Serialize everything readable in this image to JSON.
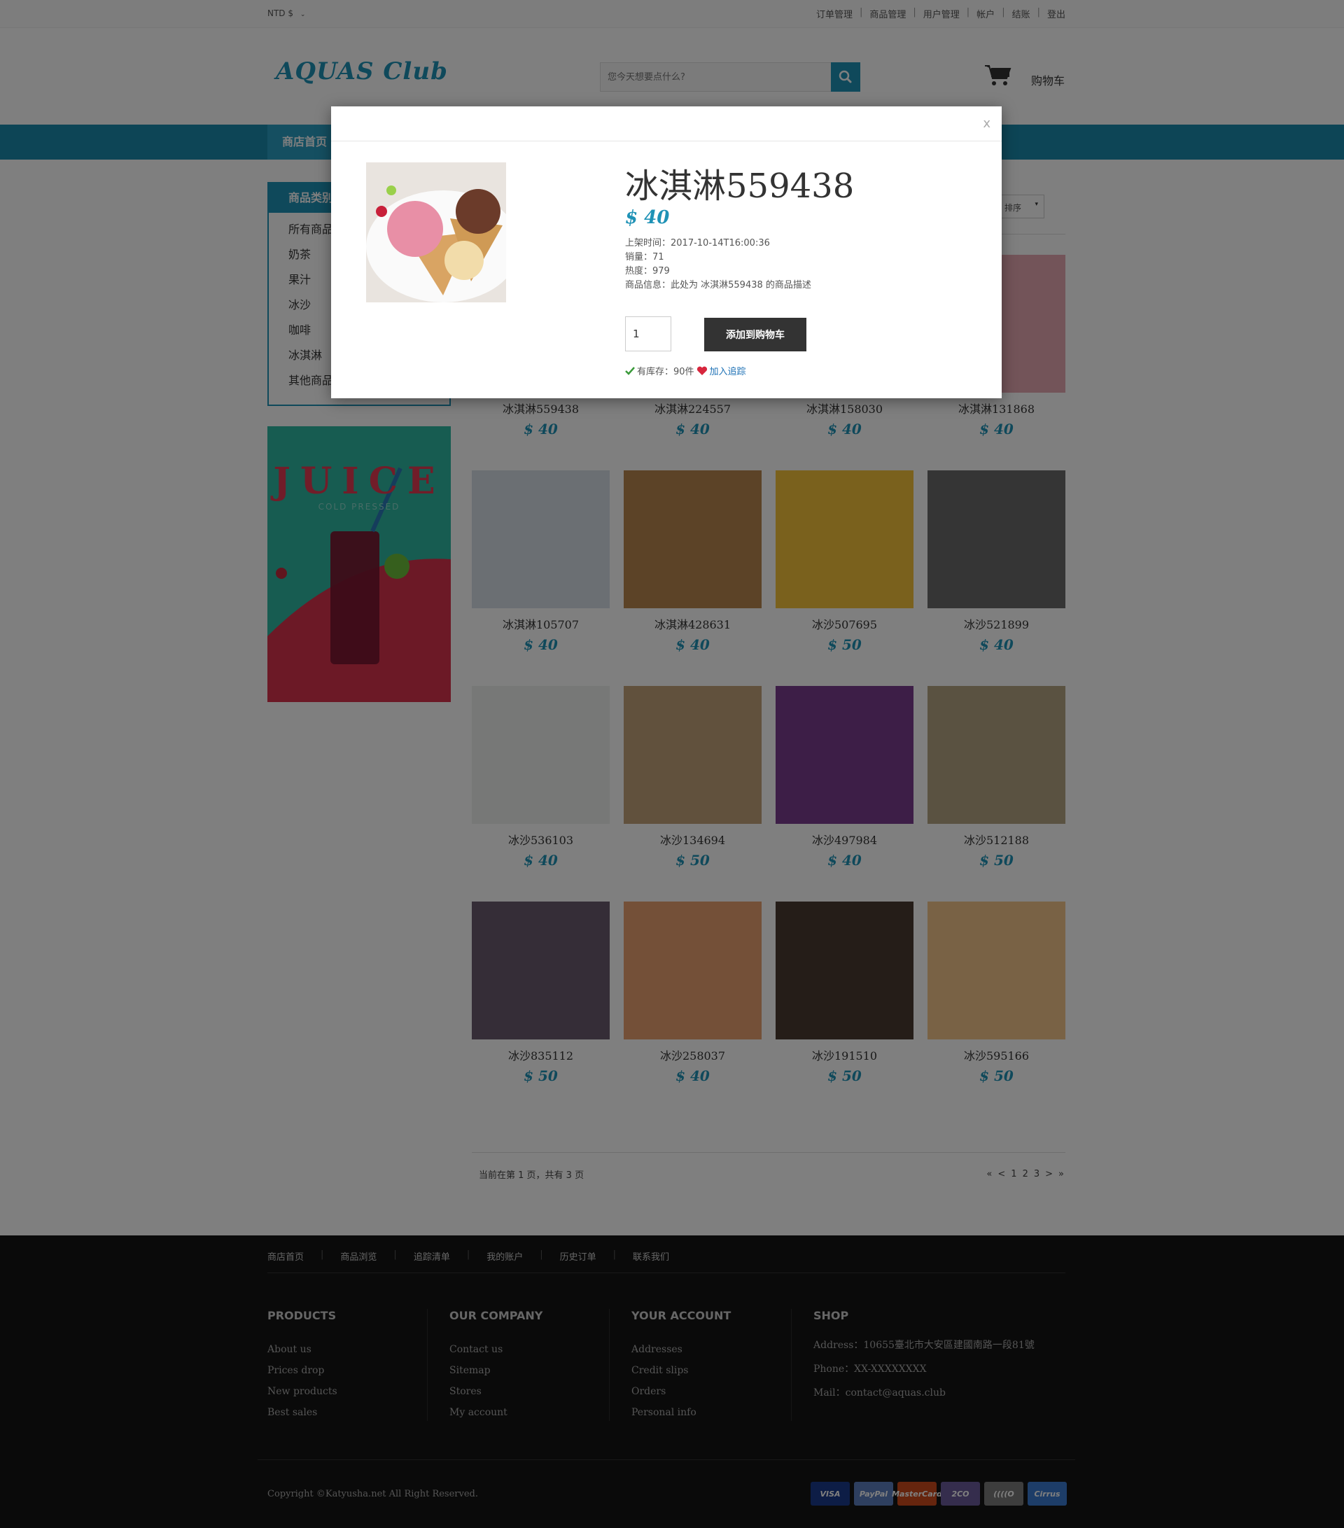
{
  "topbar": {
    "currency": "NTD $",
    "links": [
      "订单管理",
      "商品管理",
      "用户管理",
      "帐户",
      "结账",
      "登出"
    ]
  },
  "header": {
    "logo": "AQUAS Club",
    "search_placeholder": "您今天想要点什么?",
    "cart_label": "购物车"
  },
  "nav": {
    "home": "商店首页"
  },
  "sidebar": {
    "title": "商品类别",
    "items": [
      "所有商品",
      "奶茶",
      "果汁",
      "冰沙",
      "咖啡",
      "冰淇淋",
      "其他商品"
    ]
  },
  "banner": {
    "title": "JUICE",
    "subtitle": "COLD PRESSED"
  },
  "sort": {
    "label": "排序"
  },
  "products": [
    {
      "name": "冰淇淋559438",
      "price": "$ 40",
      "color": "#f1c6cf"
    },
    {
      "name": "冰淇淋224557",
      "price": "$ 40",
      "color": "#e8d8b0"
    },
    {
      "name": "冰淇淋158030",
      "price": "$ 40",
      "color": "#d9b48a"
    },
    {
      "name": "冰淇淋131868",
      "price": "$ 40",
      "color": "#e7a8b3"
    },
    {
      "name": "冰淇淋105707",
      "price": "$ 40",
      "color": "#d7dfe6"
    },
    {
      "name": "冰淇淋428631",
      "price": "$ 40",
      "color": "#b9864e"
    },
    {
      "name": "冰沙507695",
      "price": "$ 50",
      "color": "#f4c23a"
    },
    {
      "name": "冰沙521899",
      "price": "$ 40",
      "color": "#6b6b6b"
    },
    {
      "name": "冰沙536103",
      "price": "$ 40",
      "color": "#eef0ef"
    },
    {
      "name": "冰沙134694",
      "price": "$ 50",
      "color": "#c3a37a"
    },
    {
      "name": "冰沙497984",
      "price": "$ 40",
      "color": "#7a3d8e"
    },
    {
      "name": "冰沙512188",
      "price": "$ 50",
      "color": "#b5a583"
    },
    {
      "name": "冰沙835112",
      "price": "$ 50",
      "color": "#6a5a6e"
    },
    {
      "name": "冰沙258037",
      "price": "$ 40",
      "color": "#e9a071"
    },
    {
      "name": "冰沙191510",
      "price": "$ 50",
      "color": "#4a3b30"
    },
    {
      "name": "冰沙595166",
      "price": "$ 50",
      "color": "#f3c48a"
    }
  ],
  "pager": {
    "info": "当前在第 1 页，共有 3 页",
    "first": "«",
    "prev": "<",
    "pages": [
      "1",
      "2",
      "3"
    ],
    "next": ">",
    "last": "»"
  },
  "footer": {
    "links": [
      "商店首页",
      "商品浏览",
      "追踪清单",
      "我的账户",
      "历史订单",
      "联系我们"
    ],
    "products": {
      "title": "PRODUCTS",
      "items": [
        "About us",
        "Prices drop",
        "New products",
        "Best sales"
      ]
    },
    "company": {
      "title": "OUR COMPANY",
      "items": [
        "Contact us",
        "Sitemap",
        "Stores",
        "My account"
      ]
    },
    "account": {
      "title": "YOUR ACCOUNT",
      "items": [
        "Addresses",
        "Credit slips",
        "Orders",
        "Personal info"
      ]
    },
    "shop": {
      "title": "SHOP",
      "items": [
        "Address：10655臺北市大安區建國南路一段81號",
        "Phone：XX-XXXXXXXX",
        "Mail：contact@aquas.club"
      ]
    },
    "copyright": "Copyright ©Katyusha.net All Right Reserved.",
    "payments": [
      {
        "label": "VISA",
        "color": "#1a3a8c"
      },
      {
        "label": "PayPal",
        "color": "#5d7fbf"
      },
      {
        "label": "MasterCard",
        "color": "#cc4a1c"
      },
      {
        "label": "2CO",
        "color": "#6a5a9a"
      },
      {
        "label": "((((O",
        "color": "#7a7a7a"
      },
      {
        "label": "Cirrus",
        "color": "#3b7bd0"
      }
    ]
  },
  "modal": {
    "close": "x",
    "title": "冰淇淋559438",
    "price": "$ 40",
    "listed": "上架时间：2017-10-14T16:00:36",
    "sales": "销量：71",
    "heat": "热度：979",
    "desc": "商品信息：此处为 冰淇淋559438 的商品描述",
    "qty": "1",
    "add_label": "添加到购物车",
    "stock": "有库存：90件",
    "follow": "加入追踪"
  }
}
